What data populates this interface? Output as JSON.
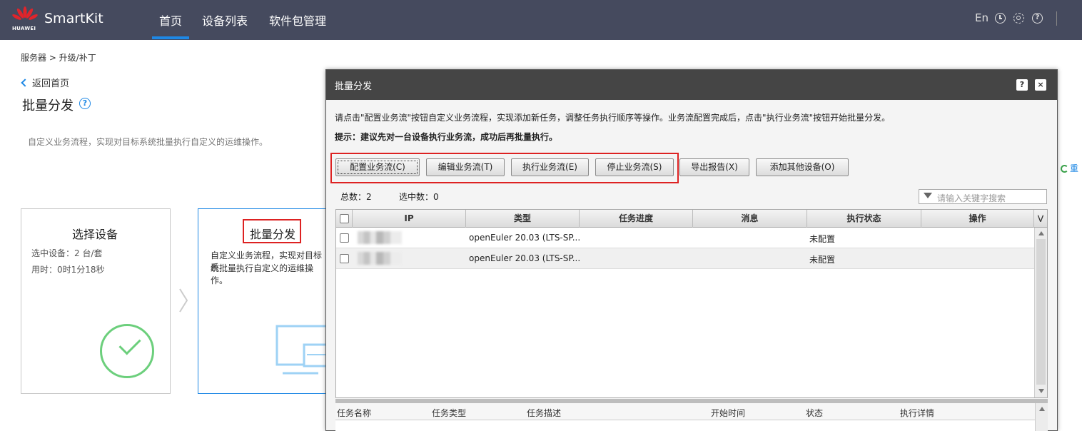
{
  "header": {
    "brand": "SmartKit",
    "logo_text": "HUAWEI",
    "nav": [
      "首页",
      "设备列表",
      "软件包管理"
    ],
    "lang": "En",
    "icons": [
      "clock-icon",
      "gear-icon",
      "help-icon"
    ]
  },
  "breadcrumb": "服务器 > 升级/补丁",
  "back_label": "返回首页",
  "page_title": "批量分发",
  "page_desc": "自定义业务流程，实现对目标系统批量执行自定义的运维操作。",
  "steps": {
    "select": {
      "title": "选择设备",
      "selected": "选中设备：2 台/套",
      "elapsed": "用时：0时1分18秒"
    },
    "distribute": {
      "title": "批量分发",
      "desc1": "自定义业务流程，实现对目标系",
      "desc2": "统批量执行自定义的运维操作。"
    }
  },
  "dialog": {
    "title": "批量分发",
    "help_btn": "?",
    "close_btn": "×",
    "instruction": "请点击\"配置业务流\"按钮自定义业务流程，实现添加新任务，调整任务执行顺序等操作。业务流配置完成后，点击\"执行业务流\"按钮开始批量分发。",
    "tip": "提示：建议先对一台设备执行业务流，成功后再批量执行。",
    "buttons": [
      "配置业务流(C)",
      "编辑业务流(T)",
      "执行业务流(E)",
      "停止业务流(S)",
      "导出报告(X)",
      "添加其他设备(O)"
    ],
    "total": "总数：2",
    "selected": "选中数：0",
    "search_placeholder": "请输入关键字搜索",
    "columns": [
      "IP",
      "类型",
      "任务进度",
      "消息",
      "执行状态",
      "操作"
    ],
    "rows": [
      {
        "type": "openEuler 20.03 (LTS-SP...",
        "status": "未配置"
      },
      {
        "type": "openEuler 20.03 (LTS-SP...",
        "status": "未配置"
      }
    ],
    "task_columns": [
      "任务名称",
      "任务类型",
      "任务描述",
      "开始时间",
      "状态",
      "执行详情"
    ]
  },
  "side_link": "重",
  "colors": {
    "nav_bg": "#454a5e",
    "accent": "#1e88e5",
    "success": "#6ccf7c",
    "highlight": "#dd2222"
  }
}
